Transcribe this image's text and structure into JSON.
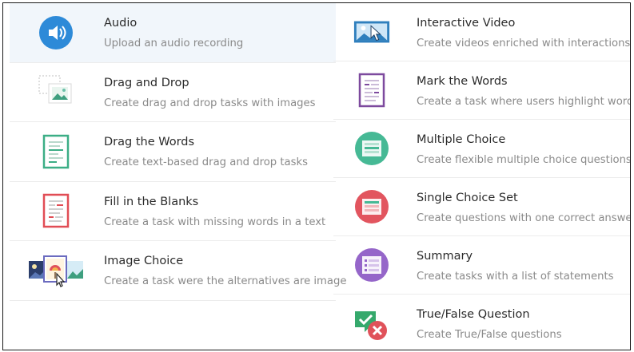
{
  "left_column": [
    {
      "title": "Audio",
      "description": "Upload an audio recording",
      "icon": "speaker-icon"
    },
    {
      "title": "Drag and Drop",
      "description": "Create drag and drop tasks with images",
      "icon": "image-drop-icon"
    },
    {
      "title": "Drag the Words",
      "description": "Create text-based drag and drop tasks",
      "icon": "document-icon"
    },
    {
      "title": "Fill in the Blanks",
      "description": "Create a task with missing words in a text",
      "icon": "document-icon"
    },
    {
      "title": "Image Choice",
      "description": "Create a task were the alternatives are image",
      "icon": "image-choice-icon"
    }
  ],
  "right_column": [
    {
      "title": "Interactive Video",
      "description": "Create videos enriched with interactions",
      "icon": "video-icon"
    },
    {
      "title": "Mark the Words",
      "description": "Create a task where users highlight words",
      "icon": "document-icon"
    },
    {
      "title": "Multiple Choice",
      "description": "Create flexible multiple choice questions",
      "icon": "list-icon"
    },
    {
      "title": "Single Choice Set",
      "description": "Create questions with one correct answer",
      "icon": "list-icon"
    },
    {
      "title": "Summary",
      "description": "Create tasks with a list of statements",
      "icon": "checklist-icon"
    },
    {
      "title": "True/False Question",
      "description": "Create True/False questions",
      "icon": "check-cross-icon"
    }
  ],
  "colors": {
    "audio": "#2d8ad8",
    "drag_drop": "#6cc1a9",
    "drag_words": "#3cae86",
    "fill_blanks": "#e14d55",
    "interactive_video": "#2f7fbd",
    "mark_words": "#7d4a9e",
    "multiple_choice": "#46b995",
    "single_choice": "#e2555f",
    "summary": "#9566c9",
    "true_false_check": "#35a96c",
    "true_false_cross": "#e0525a"
  }
}
